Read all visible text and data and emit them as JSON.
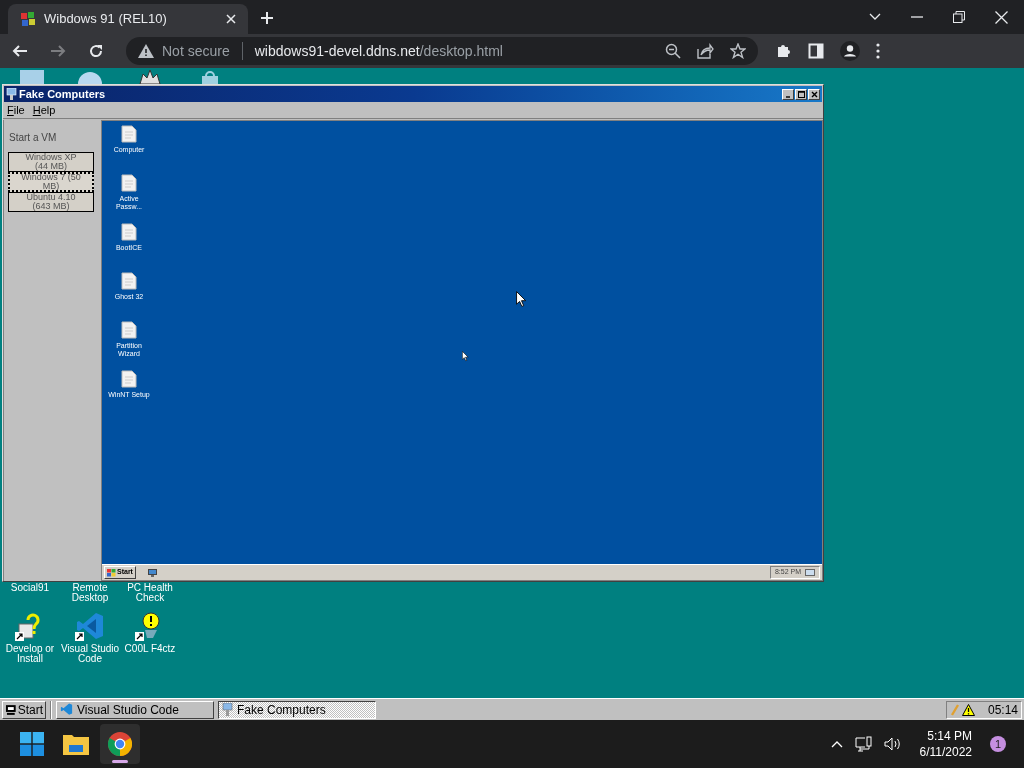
{
  "browser": {
    "tab": {
      "title": "Wibdows 91 (REL10)",
      "selected": true
    },
    "nav": [
      {
        "kind": "back",
        "disabled": false
      },
      {
        "kind": "forward",
        "disabled": true
      },
      {
        "kind": "reload",
        "disabled": false
      }
    ],
    "address": {
      "security": "Not secure",
      "host": "wibdows91-devel.ddns.net",
      "path": "/desktop.html"
    }
  },
  "desktop": {
    "hidden_icons": [
      {
        "kind": "monitor"
      },
      {
        "kind": "globe"
      },
      {
        "kind": "gear"
      },
      {
        "kind": "bag"
      }
    ],
    "covered_labels": [
      "Social91",
      "Remote Desktop",
      "PC Health Check"
    ],
    "icons": [
      {
        "label": "Develop or Install",
        "kind": "help"
      },
      {
        "label": "Visual Studio Code",
        "kind": "vscode"
      },
      {
        "label": "C00L F4ctz",
        "kind": "bulb"
      }
    ]
  },
  "window": {
    "title": "Fake Computers",
    "menu": [
      "File",
      "Help"
    ],
    "sidebar": {
      "heading": "Start a VM",
      "buttons": [
        {
          "label": "Windows XP (44 MB)",
          "focused": false
        },
        {
          "label": "Windows 7 (50 MB)",
          "focused": true
        },
        {
          "label": "Ubuntu 4.10 (643 MB)",
          "focused": false
        }
      ]
    },
    "vm": {
      "icons": [
        "Computer",
        "Active Passw...",
        "BootICE",
        "Ghost 32",
        "Partition Wizard",
        "WinNT Setup"
      ],
      "start": "Start",
      "clock": "8:52 PM"
    }
  },
  "taskbar": {
    "start": "Start",
    "tasks": [
      {
        "label": "Visual Studio Code",
        "kind": "vscode",
        "selected": false
      },
      {
        "label": "Fake Computers",
        "kind": "computer",
        "selected": true
      }
    ],
    "clock": "05:14"
  },
  "os_taskbar": {
    "apps": [
      {
        "kind": "windows",
        "selected": false
      },
      {
        "kind": "explorer",
        "selected": false
      },
      {
        "kind": "chrome",
        "selected": true
      }
    ],
    "time": "5:14 PM",
    "date": "6/11/2022",
    "notifications": "1"
  }
}
